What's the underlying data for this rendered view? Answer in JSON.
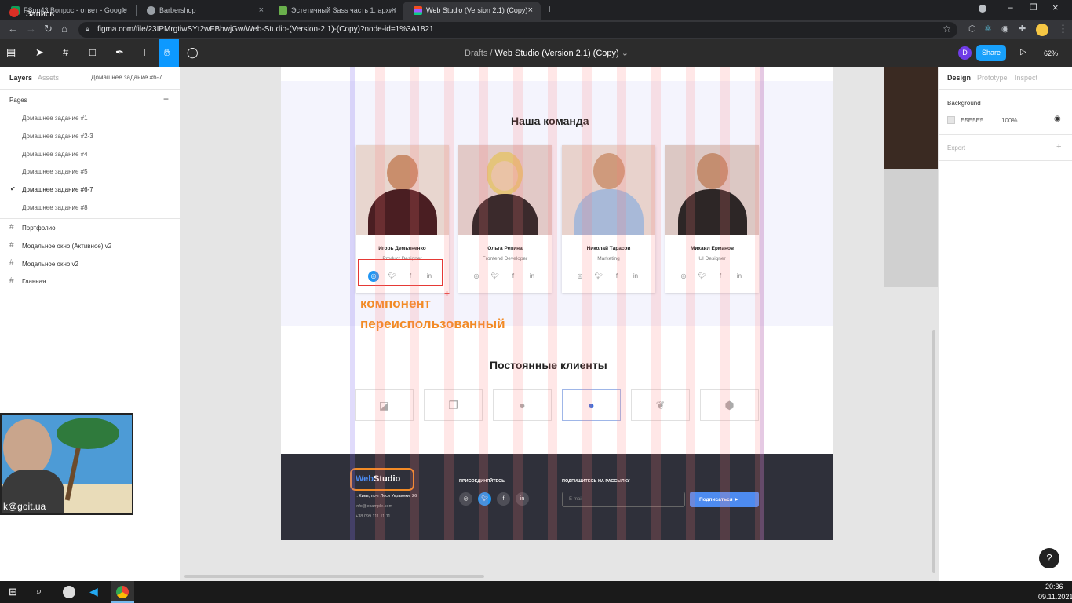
{
  "colors": {
    "accent": "#0d99ff",
    "orange": "#f28b26",
    "footer": "#2f303a",
    "pink_columns": "#ffb3b3",
    "send": "#4d8bf0"
  },
  "recording": {
    "label": "Запись"
  },
  "tabs": [
    {
      "title": "FSon43 Вопрос - ответ - Google",
      "icon": "sheets-icon"
    },
    {
      "title": "Barbershop",
      "icon": "globe-icon"
    },
    {
      "title": "Эстетичный Sass часть 1: архит",
      "icon": "p-icon"
    },
    {
      "title": "Web Studio (Version 2.1) (Copy)",
      "icon": "figma-icon"
    }
  ],
  "address": {
    "url": "figma.com/file/23IPMrgtiwSYt2wFBbwjGw/Web-Studio-(Version-2.1)-(Copy)?node-id=1%3A1821"
  },
  "toolbar": {
    "drafts": "Drafts",
    "separator": "/",
    "file": "Web Studio (Version 2.1) (Copy)",
    "share": "Share",
    "avatar": "D",
    "zoom": "62%"
  },
  "left_panel": {
    "tab_layers": "Layers",
    "tab_assets": "Assets",
    "current_page": "Домашнее задание #6-7",
    "pages_title": "Pages",
    "pages": [
      "Домашнее задание #1",
      "Домашнее задание #2-3",
      "Домашнее задание #4",
      "Домашнее задание #5",
      "Домашнее задание #6-7",
      "Домашнее задание #8"
    ],
    "frames": [
      "Портфолио",
      "Модальное окно (Активное) v2",
      "Модальное окно v2",
      "Главная"
    ]
  },
  "right_panel": {
    "tabs": [
      "Design",
      "Prototype",
      "Inspect"
    ],
    "background_label": "Background",
    "bg_hex": "E5E5E5",
    "bg_opacity": "100%",
    "export_label": "Export"
  },
  "design": {
    "team_title": "Наша команда",
    "members": [
      {
        "name": "Игорь Демьяненко",
        "role": "Product Designer"
      },
      {
        "name": "Ольга Репина",
        "role": "Frontend Developer"
      },
      {
        "name": "Николай Тарасов",
        "role": "Marketing"
      },
      {
        "name": "Михаил Ерманов",
        "role": "UI Designer"
      }
    ],
    "annotation": {
      "line1": "компонент",
      "line2": "переиспользованный"
    },
    "clients_title": "Постоянные клиенты",
    "footer": {
      "logo_web": "Web",
      "logo_studio": "Studio",
      "address": "г. Киев, пр-т Леси Украинки, 26",
      "email": "info@example.com",
      "phone": "+38 099 111 11 11",
      "join": "ПРИСОЕДИНЯЙТЕСЬ",
      "subscribe_title": "ПОДПИШИТЕСЬ НА РАССЫЛКУ",
      "email_placeholder": "E-mail",
      "subscribe_button": "Подписаться"
    }
  },
  "webcam": {
    "caption": "k@goit.ua"
  },
  "taskbar": {
    "time": "20:36",
    "date": "09.11.2021"
  },
  "help": "?"
}
